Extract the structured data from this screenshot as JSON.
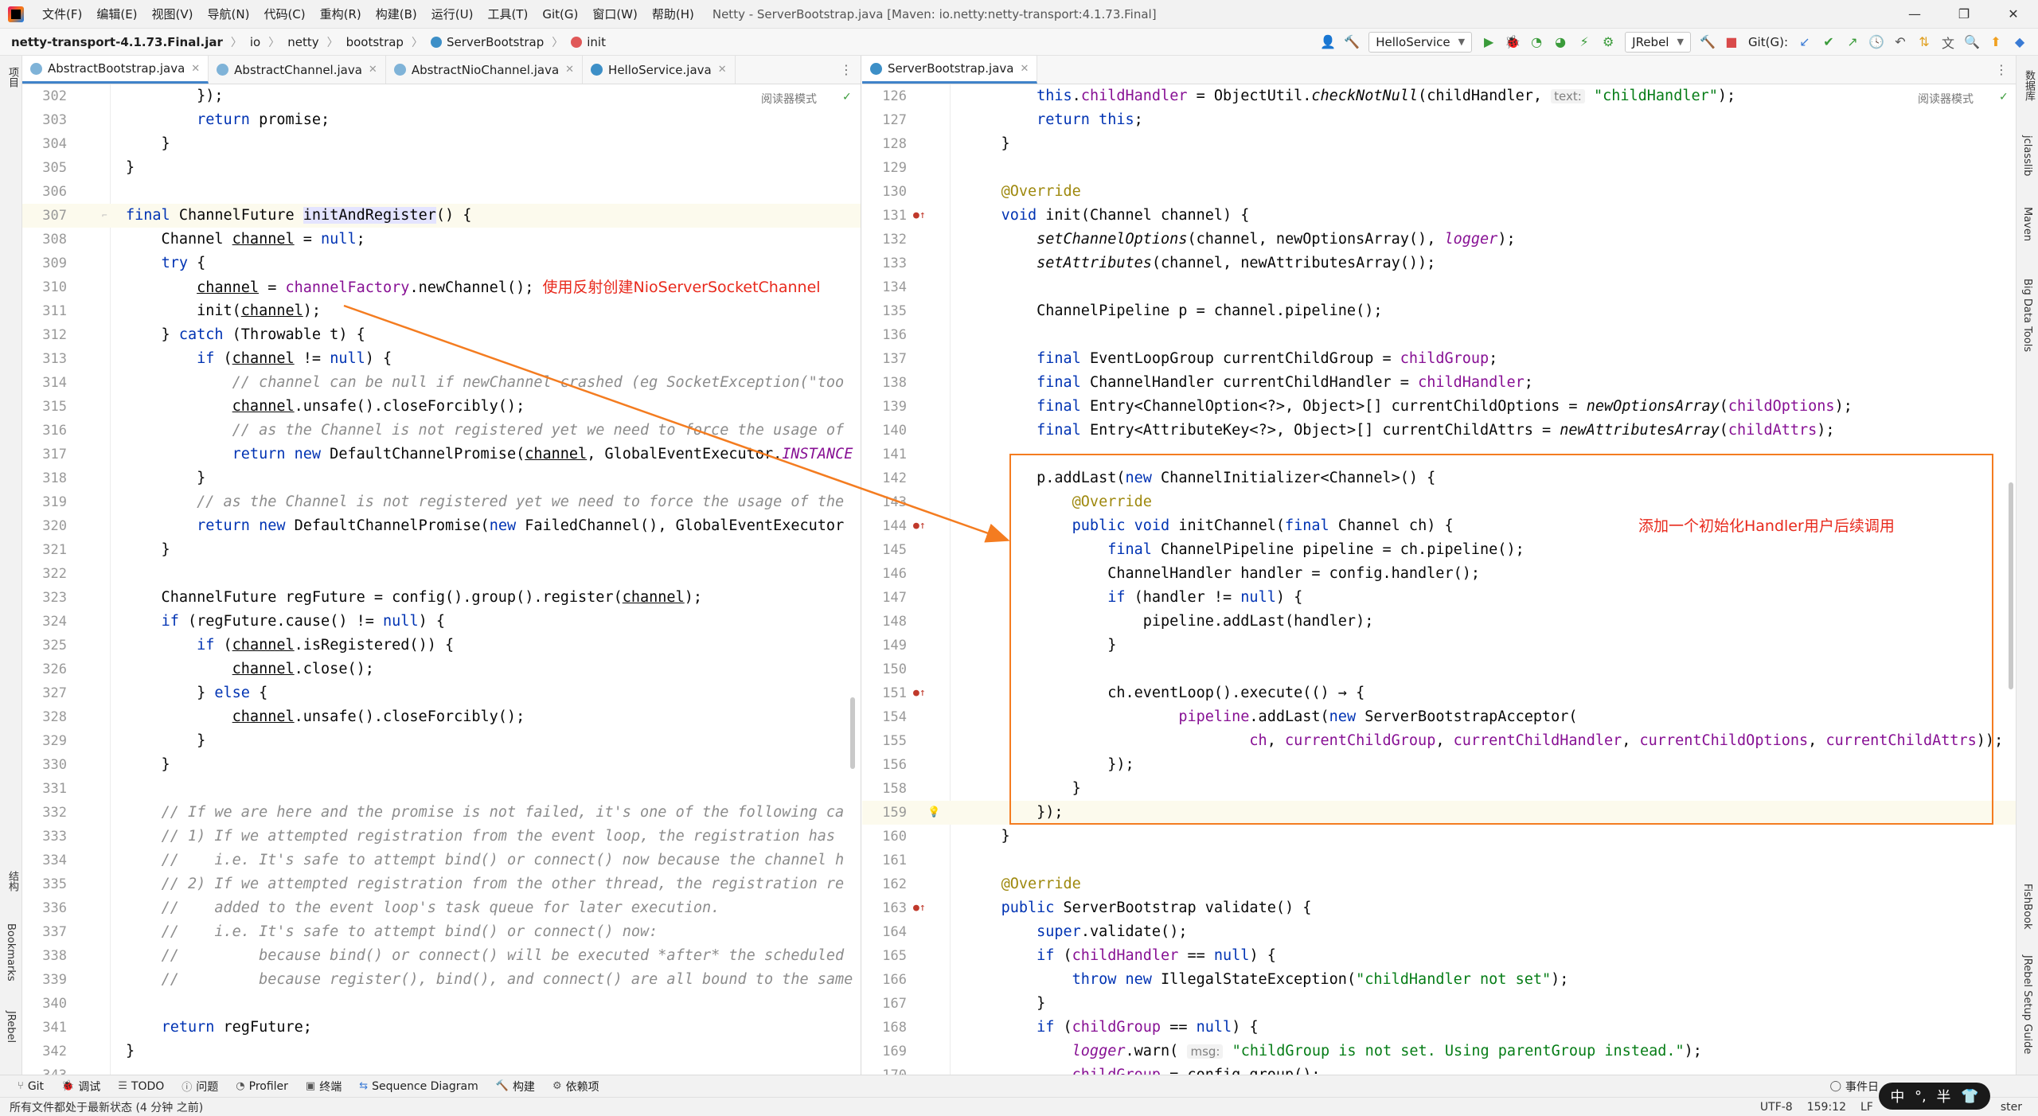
{
  "app": {
    "menu": [
      "文件(F)",
      "编辑(E)",
      "视图(V)",
      "导航(N)",
      "代码(C)",
      "重构(R)",
      "构建(B)",
      "运行(U)",
      "工具(T)",
      "Git(G)",
      "窗口(W)",
      "帮助(H)"
    ],
    "window_title": "Netty - ServerBootstrap.java [Maven: io.netty:netty-transport:4.1.73.Final]",
    "win_minimize": "—",
    "win_restore": "❐",
    "win_close": "✕"
  },
  "breadcrumb": [
    "netty-transport-4.1.73.Final.jar",
    "io",
    "netty",
    "bootstrap",
    "ServerBootstrap",
    "init"
  ],
  "toolbar": {
    "run_config": "HelloService",
    "jrebel": "JRebel",
    "git_label": "Git(G):"
  },
  "left_stripe": [
    "项目",
    "结构",
    "Bookmarks",
    "JRebel"
  ],
  "right_stripe": [
    "数据库",
    "jclasslib",
    "Maven",
    "Big Data Tools",
    "FishBook",
    "JRebel Setup Guide"
  ],
  "left_editor": {
    "tabs": [
      "AbstractBootstrap.java",
      "AbstractChannel.java",
      "AbstractNioChannel.java",
      "HelloService.java"
    ],
    "reader_mode": "阅读器模式",
    "annotation": "使用反射创建NioServerSocketChannel"
  },
  "right_editor": {
    "tabs": [
      "ServerBootstrap.java"
    ],
    "reader_mode": "阅读器模式",
    "annotation": "添加一个初始化Handler用户后续调用"
  },
  "bottom_tools": [
    "Git",
    "调试",
    "TODO",
    "问题",
    "Profiler",
    "终端",
    "Sequence Diagram",
    "构建",
    "依赖项"
  ],
  "status": {
    "message": "所有文件都处于最新状态 (4 分钟 之前)",
    "event_log": "事件日",
    "encoding": "UTF-8",
    "position": "159:12",
    "line_sep": "LF",
    "tail": "ster"
  },
  "ime": [
    "中",
    "°,",
    "半",
    "👕"
  ]
}
